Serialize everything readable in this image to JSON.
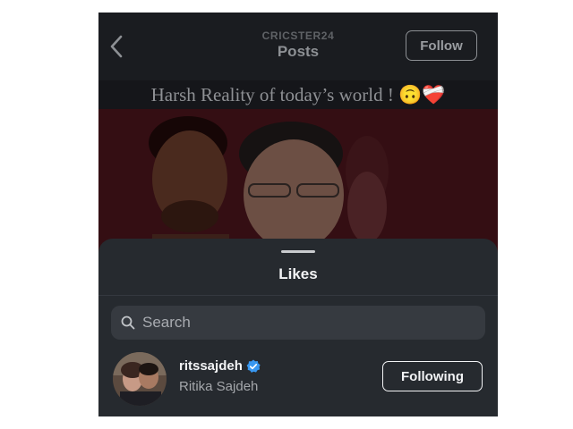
{
  "header": {
    "username": "CRICSTER24",
    "title": "Posts",
    "follow_label": "Follow"
  },
  "post": {
    "caption": "Harsh Reality of today’s world ! 🙃❤️‍🩹"
  },
  "sheet": {
    "title": "Likes",
    "search_placeholder": "Search"
  },
  "likes": [
    {
      "username": "ritssajdeh",
      "full_name": "Ritika Sajdeh",
      "verified": true,
      "button_label": "Following"
    }
  ],
  "colors": {
    "sheet_bg": "#262a2f",
    "verified_blue": "#3897f0"
  },
  "icons": [
    "back-icon",
    "search-icon",
    "verified-badge-icon"
  ]
}
